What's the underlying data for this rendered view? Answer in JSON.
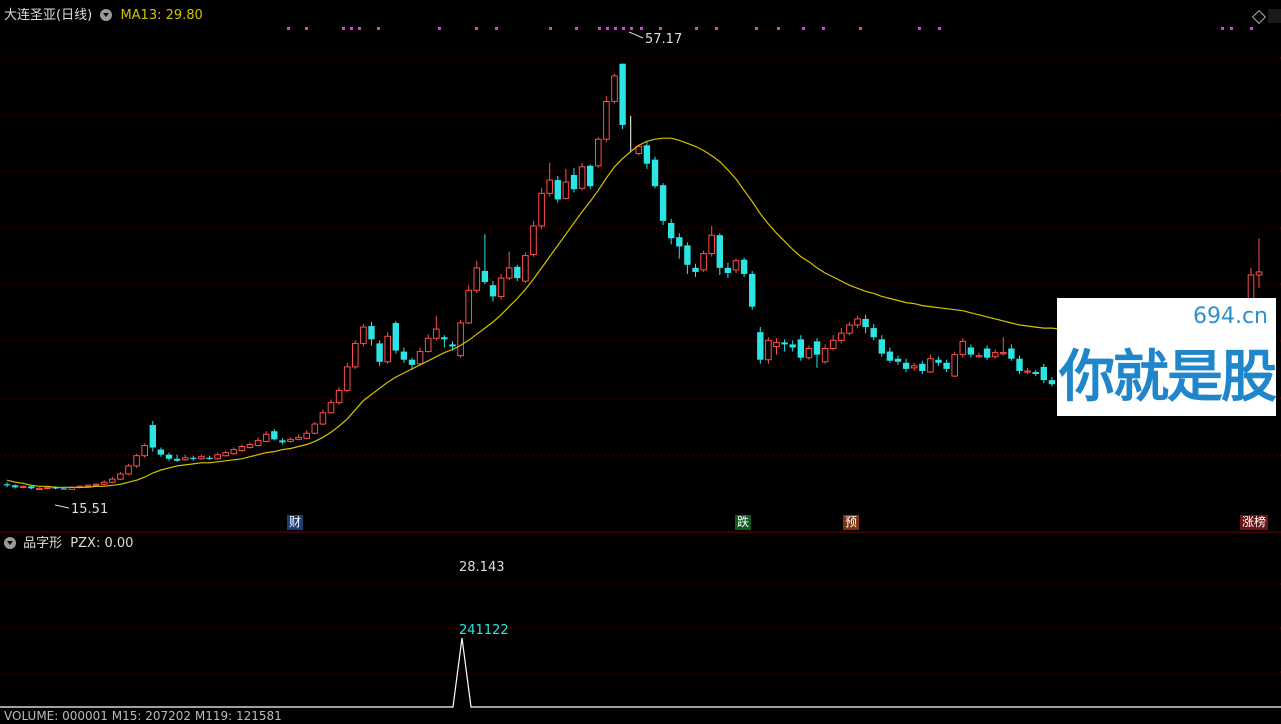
{
  "header": {
    "stock_name": "大连圣亚(日线)",
    "ma_label": "MA13: 29.80",
    "ma_color": "#d4c200"
  },
  "sub_header": {
    "indicator_name": "品字形",
    "value_label": "PZX: 0.00",
    "peak_value": "28.143",
    "peak_date": "241122"
  },
  "bottom_bar": {
    "text": "VOLUME: 000001  M15: 207202  M119: 121581"
  },
  "markers": [
    {
      "label": "财",
      "color": "#2060c0"
    },
    {
      "label": "跌",
      "color": "#1a8a2a"
    },
    {
      "label": "预",
      "color": "#c05010"
    },
    {
      "label": "涨榜",
      "color": "#c02020"
    }
  ],
  "watermark": {
    "domain": "694.cn",
    "text": "你就是股神"
  },
  "colors": {
    "up": "#ff4d4d",
    "down": "#2ce4e4",
    "ma": "#d4c200",
    "dots": "#d640e0",
    "grid": "#6a0000"
  },
  "chart_data": {
    "type": "candlestick",
    "price_range": [
      12.5,
      60.5
    ],
    "high_label": "57.17",
    "low_label": "15.51",
    "candles": [
      [
        16.0,
        15.9,
        16.2,
        15.7
      ],
      [
        15.9,
        15.7,
        16.0,
        15.6
      ],
      [
        15.7,
        15.8,
        15.9,
        15.6
      ],
      [
        15.8,
        15.6,
        15.9,
        15.5
      ],
      [
        15.6,
        15.6,
        15.7,
        15.5
      ],
      [
        15.6,
        15.7,
        15.8,
        15.5
      ],
      [
        15.7,
        15.6,
        15.8,
        15.5
      ],
      [
        15.6,
        15.5,
        15.7,
        15.5
      ],
      [
        15.5,
        15.7,
        15.8,
        15.5
      ],
      [
        15.7,
        15.8,
        15.9,
        15.6
      ],
      [
        15.8,
        15.9,
        16.0,
        15.7
      ],
      [
        15.9,
        16.0,
        16.1,
        15.8
      ],
      [
        16.0,
        16.2,
        16.4,
        15.9
      ],
      [
        16.2,
        16.5,
        16.7,
        16.1
      ],
      [
        16.5,
        17.0,
        17.2,
        16.4
      ],
      [
        17.0,
        17.8,
        18.0,
        16.9
      ],
      [
        17.8,
        18.8,
        19.0,
        17.6
      ],
      [
        18.8,
        19.8,
        20.0,
        18.6
      ],
      [
        21.8,
        19.6,
        22.2,
        19.2
      ],
      [
        19.4,
        18.9,
        19.6,
        18.7
      ],
      [
        18.9,
        18.5,
        19.1,
        18.3
      ],
      [
        18.5,
        18.3,
        18.9,
        18.2
      ],
      [
        18.4,
        18.6,
        18.9,
        18.3
      ],
      [
        18.6,
        18.5,
        18.8,
        18.3
      ],
      [
        18.5,
        18.7,
        18.9,
        18.4
      ],
      [
        18.6,
        18.5,
        18.8,
        18.4
      ],
      [
        18.5,
        18.9,
        19.1,
        18.4
      ],
      [
        18.8,
        19.1,
        19.3,
        18.7
      ],
      [
        19.0,
        19.4,
        19.6,
        18.9
      ],
      [
        19.3,
        19.7,
        19.9,
        19.2
      ],
      [
        19.6,
        19.9,
        20.1,
        19.5
      ],
      [
        19.8,
        20.3,
        20.6,
        19.7
      ],
      [
        20.2,
        20.9,
        21.2,
        20.1
      ],
      [
        21.2,
        20.4,
        21.4,
        20.3
      ],
      [
        20.3,
        20.1,
        20.5,
        19.9
      ],
      [
        20.2,
        20.4,
        20.6,
        20.1
      ],
      [
        20.4,
        20.6,
        20.9,
        20.3
      ],
      [
        20.5,
        21.0,
        21.3,
        20.4
      ],
      [
        21.0,
        21.9,
        22.1,
        20.9
      ],
      [
        21.9,
        23.0,
        23.3,
        21.8
      ],
      [
        23.0,
        24.0,
        24.3,
        22.9
      ],
      [
        24.0,
        25.2,
        25.5,
        23.8
      ],
      [
        25.2,
        27.5,
        27.9,
        25.0
      ],
      [
        27.5,
        29.8,
        30.1,
        27.3
      ],
      [
        29.8,
        31.4,
        31.7,
        29.5
      ],
      [
        31.5,
        30.2,
        31.9,
        29.6
      ],
      [
        29.8,
        28.0,
        30.1,
        27.6
      ],
      [
        28.0,
        30.5,
        30.9,
        27.8
      ],
      [
        31.8,
        29.1,
        32.0,
        28.8
      ],
      [
        29.0,
        28.2,
        29.4,
        27.9
      ],
      [
        28.2,
        27.7,
        28.4,
        27.2
      ],
      [
        27.8,
        29.0,
        29.4,
        27.6
      ],
      [
        29.0,
        30.3,
        30.7,
        28.9
      ],
      [
        30.3,
        31.2,
        32.5,
        30.1
      ],
      [
        30.4,
        30.2,
        30.6,
        29.4
      ],
      [
        29.7,
        29.5,
        30.0,
        29.1
      ],
      [
        28.6,
        31.8,
        32.1,
        28.4
      ],
      [
        31.8,
        35.0,
        35.5,
        31.7
      ],
      [
        35.0,
        37.2,
        37.9,
        34.7
      ],
      [
        36.9,
        35.8,
        40.5,
        35.6
      ],
      [
        35.5,
        34.4,
        35.9,
        33.9
      ],
      [
        34.4,
        36.2,
        36.6,
        34.1
      ],
      [
        36.2,
        37.2,
        38.8,
        36.0
      ],
      [
        37.3,
        36.2,
        37.5,
        35.9
      ],
      [
        35.9,
        38.4,
        38.7,
        35.7
      ],
      [
        38.5,
        41.3,
        41.8,
        38.3
      ],
      [
        41.3,
        44.5,
        45.0,
        41.0
      ],
      [
        44.5,
        45.8,
        47.5,
        44.2
      ],
      [
        45.8,
        43.9,
        46.2,
        43.6
      ],
      [
        44.0,
        45.6,
        46.9,
        43.9
      ],
      [
        46.3,
        44.9,
        47.0,
        44.6
      ],
      [
        45.0,
        47.1,
        47.5,
        44.8
      ],
      [
        47.2,
        45.2,
        47.3,
        44.9
      ],
      [
        47.2,
        49.8,
        50.0,
        47.0
      ],
      [
        49.8,
        53.5,
        54.0,
        49.5
      ],
      [
        53.5,
        56.0,
        56.2,
        53.3
      ],
      [
        57.2,
        51.2,
        57.2,
        50.8
      ],
      [
        0,
        0,
        52.1,
        48.6
      ],
      [
        48.4,
        49.1,
        49.3,
        48.2
      ],
      [
        49.2,
        47.4,
        49.6,
        46.9
      ],
      [
        47.8,
        45.2,
        48.1,
        45.0
      ],
      [
        45.3,
        41.8,
        45.5,
        41.4
      ],
      [
        41.6,
        40.1,
        42.0,
        39.5
      ],
      [
        40.2,
        39.3,
        40.6,
        38.1
      ],
      [
        39.4,
        37.5,
        39.7,
        36.6
      ],
      [
        37.2,
        36.8,
        37.6,
        36.3
      ],
      [
        37.0,
        38.6,
        38.9,
        36.8
      ],
      [
        38.6,
        40.4,
        41.3,
        38.3
      ],
      [
        40.4,
        37.2,
        40.6,
        36.5
      ],
      [
        37.2,
        36.7,
        37.7,
        36.2
      ],
      [
        37.0,
        37.9,
        38.1,
        36.7
      ],
      [
        38.0,
        36.6,
        38.2,
        36.3
      ],
      [
        36.6,
        33.4,
        36.9,
        33.1
      ],
      [
        30.9,
        28.2,
        31.4,
        27.8
      ],
      [
        28.2,
        30.1,
        30.4,
        27.8
      ],
      [
        29.5,
        29.9,
        30.3,
        28.7
      ],
      [
        29.9,
        29.7,
        30.2,
        29.0
      ],
      [
        29.7,
        29.4,
        30.1,
        29.0
      ],
      [
        30.2,
        28.4,
        30.6,
        28.1
      ],
      [
        28.4,
        29.3,
        29.6,
        28.2
      ],
      [
        30.0,
        28.7,
        30.3,
        27.4
      ],
      [
        28.0,
        29.3,
        29.7,
        27.8
      ],
      [
        29.3,
        30.1,
        30.6,
        29.1
      ],
      [
        30.1,
        30.8,
        31.3,
        29.8
      ],
      [
        30.8,
        31.6,
        31.9,
        30.6
      ],
      [
        31.6,
        32.2,
        32.5,
        31.3
      ],
      [
        32.2,
        31.4,
        32.6,
        30.8
      ],
      [
        31.3,
        30.4,
        31.7,
        30.1
      ],
      [
        30.2,
        28.8,
        30.6,
        28.5
      ],
      [
        29.0,
        28.1,
        29.4,
        27.9
      ],
      [
        28.3,
        28.0,
        28.6,
        27.7
      ],
      [
        27.9,
        27.3,
        28.3,
        27.0
      ],
      [
        27.4,
        27.6,
        27.9,
        27.1
      ],
      [
        27.8,
        27.1,
        28.1,
        26.8
      ],
      [
        27.0,
        28.3,
        28.7,
        26.9
      ],
      [
        28.2,
        27.9,
        28.5,
        27.6
      ],
      [
        27.9,
        27.3,
        28.2,
        27.0
      ],
      [
        26.6,
        28.7,
        29.0,
        26.5
      ],
      [
        28.7,
        30.0,
        30.3,
        28.4
      ],
      [
        29.4,
        28.7,
        29.7,
        28.4
      ],
      [
        28.6,
        28.6,
        28.9,
        28.4
      ],
      [
        29.3,
        28.4,
        29.6,
        28.2
      ],
      [
        28.5,
        28.9,
        29.2,
        28.3
      ],
      [
        28.8,
        28.9,
        30.4,
        28.6
      ],
      [
        29.3,
        28.3,
        29.7,
        28.1
      ],
      [
        28.3,
        27.1,
        28.6,
        26.8
      ],
      [
        27.0,
        27.1,
        27.4,
        26.8
      ],
      [
        27.0,
        26.8,
        27.2,
        26.6
      ],
      [
        27.5,
        26.2,
        27.8,
        25.9
      ],
      [
        26.2,
        25.8,
        26.5,
        25.6
      ],
      [
        25.8,
        25.7,
        26.0,
        25.5
      ],
      [
        25.7,
        25.4,
        25.9,
        25.2
      ],
      [
        25.4,
        25.3,
        25.6,
        25.1
      ],
      [
        25.3,
        25.0,
        25.5,
        24.8
      ],
      [
        24.8,
        24.5,
        25.1,
        24.3
      ],
      [
        24.4,
        24.3,
        24.7,
        24.1
      ]
    ],
    "tail_candles": [
      [
        33.0,
        36.5,
        37.2,
        32.5
      ],
      [
        36.5,
        36.8,
        40.1,
        35.2
      ]
    ],
    "ma13": [
      16.4,
      16.2,
      16.1,
      15.9,
      15.8,
      15.8,
      15.7,
      15.7,
      15.7,
      15.7,
      15.7,
      15.8,
      15.8,
      15.9,
      16.0,
      16.2,
      16.4,
      16.7,
      17.1,
      17.4,
      17.6,
      17.8,
      17.9,
      18.0,
      18.1,
      18.1,
      18.2,
      18.3,
      18.4,
      18.5,
      18.7,
      18.9,
      19.1,
      19.2,
      19.4,
      19.5,
      19.7,
      19.9,
      20.2,
      20.6,
      21.1,
      21.7,
      22.4,
      23.3,
      24.2,
      24.8,
      25.4,
      26.0,
      26.5,
      26.9,
      27.3,
      27.7,
      28.1,
      28.5,
      28.9,
      29.2,
      29.6,
      30.1,
      30.7,
      31.3,
      31.9,
      32.6,
      33.4,
      34.2,
      35.1,
      36.1,
      37.2,
      38.3,
      39.4,
      40.5,
      41.6,
      42.7,
      43.7,
      44.8,
      46.0,
      47.1,
      47.9,
      48.6,
      49.2,
      49.6,
      49.8,
      49.9,
      49.9,
      49.7,
      49.4,
      49.1,
      48.7,
      48.2,
      47.6,
      46.8,
      45.9,
      44.8,
      43.7,
      42.5,
      41.5,
      40.6,
      39.8,
      39.0,
      38.3,
      37.8,
      37.2,
      36.7,
      36.3,
      35.9,
      35.5,
      35.2,
      34.9,
      34.7,
      34.4,
      34.2,
      34.0,
      33.8,
      33.7,
      33.5,
      33.4,
      33.3,
      33.2,
      33.1,
      33.0,
      32.8,
      32.6,
      32.4,
      32.2,
      32.0,
      31.8,
      31.6,
      31.5,
      31.4,
      31.3,
      31.3,
      31.2,
      31.1,
      31.0,
      30.9,
      30.8,
      30.7
    ]
  },
  "sub_chart_data": {
    "type": "line",
    "values_nonzero": [
      {
        "index": 77,
        "value": 28.143
      }
    ],
    "ylim": [
      0,
      28.143
    ]
  }
}
